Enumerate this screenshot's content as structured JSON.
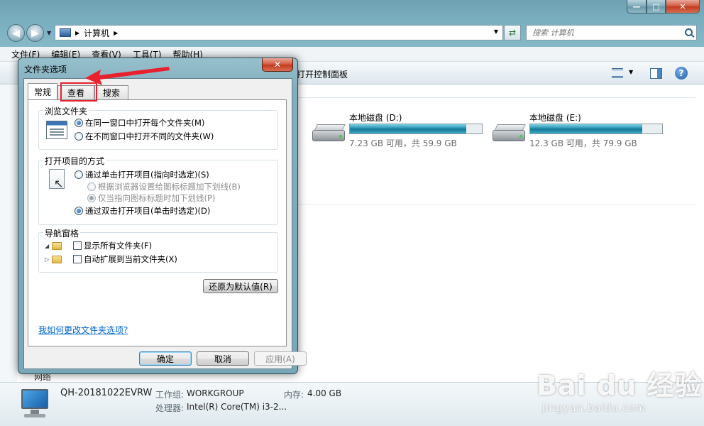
{
  "explorer": {
    "address": {
      "crumb": "计算机"
    },
    "search": {
      "placeholder": "搜索 计算机"
    },
    "menu": [
      "文件(F)",
      "编辑(E)",
      "查看(V)",
      "工具(T)",
      "帮助(H)"
    ],
    "toolbar": {
      "control_panel": "打开控制面板"
    },
    "drives": [
      {
        "name": "本地磁盘 (D:)",
        "free": "7.23 GB 可用，共 59.9 GB",
        "used_fraction": 0.88
      },
      {
        "name": "本地磁盘 (E:)",
        "free": "12.3 GB 可用，共 79.9 GB",
        "used_fraction": 0.85
      }
    ],
    "nav_pane": {
      "network": "网络"
    },
    "status": {
      "computer_name": "QH-20181022EVRW",
      "workgroup_label": "工作组:",
      "workgroup": "WORKGROUP",
      "memory_label": "内存:",
      "memory": "4.00 GB",
      "processor_label": "处理器:",
      "processor": "Intel(R) Core(TM) i3-2..."
    }
  },
  "dialog": {
    "title": "文件夹选项",
    "tabs": [
      "常规",
      "查看",
      "搜索"
    ],
    "browse": {
      "title": "浏览文件夹",
      "options": [
        "在同一窗口中打开每个文件夹(M)",
        "在不同窗口中打开不同的文件夹(W)"
      ],
      "selected": 0
    },
    "click": {
      "title": "打开项目的方式",
      "single": "通过单击打开项目(指向时选定)(S)",
      "sub_options": [
        "根据浏览器设置给图标标题加下划线(B)",
        "仅当指向图标标题时加下划线(P)"
      ],
      "double": "通过双击打开项目(单击时选定)(D)"
    },
    "nav": {
      "title": "导航窗格",
      "options": [
        "显示所有文件夹(F)",
        "自动扩展到当前文件夹(X)"
      ]
    },
    "restore_button": "还原为默认值(R)",
    "help_link": "我如何更改文件夹选项?",
    "buttons": {
      "ok": "确定",
      "cancel": "取消",
      "apply": "应用(A)"
    }
  },
  "watermark": {
    "main": "Bai du 经验",
    "sub": "jingyan.baidu.com"
  },
  "colors": {
    "annotation": "#e8212f",
    "link": "#0066cc",
    "drive_fill": "#1b8aa8"
  }
}
